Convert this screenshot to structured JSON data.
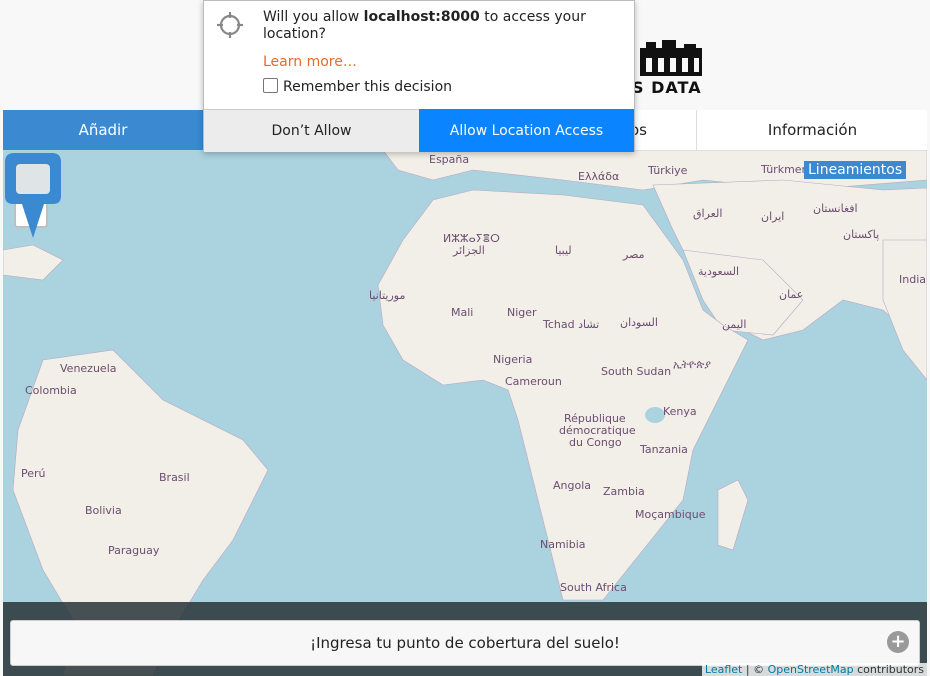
{
  "header": {
    "logo_text": "S DATA"
  },
  "tabs": [
    {
      "label": "Añadir"
    },
    {
      "label": "os"
    },
    {
      "label": "Información"
    }
  ],
  "map": {
    "zoom_in": "+",
    "zoom_out": "−",
    "lineamientos": "Lineamientos",
    "labels": {
      "espana": "España",
      "ellada": "Ελλάδα",
      "turkiye": "Türkiye",
      "turkmen": "Türkmen",
      "algeria_tifinagh": "ⵍⵣⵣⴰⵢⴻⵔ",
      "algeria": "الجزائر",
      "libya": "ليبيا",
      "egypt": "مصر",
      "iraq": "العراق",
      "iran": "ایران",
      "afghanistan": "افغانستان",
      "pakistan": "پاکستان",
      "saudi": "السعودية",
      "oman": "عمان",
      "india": "India",
      "mauritania": "موريتانيا",
      "mali": "Mali",
      "niger": "Niger",
      "tchad": "Tchad تشاد",
      "sudan": "السودان",
      "yemen": "اليمن",
      "ethiopia": "ኢትዮጵያ",
      "nigeria": "Nigeria",
      "cameroun": "Cameroun",
      "south_sudan": "South Sudan",
      "venezuela": "Venezuela",
      "colombia": "Colombia",
      "rdc_1": "République",
      "rdc_2": "démocratique",
      "rdc_3": "du Congo",
      "kenya": "Kenya",
      "tanzania": "Tanzania",
      "peru": "Perú",
      "brasil": "Brasil",
      "angola": "Angola",
      "zambia": "Zambia",
      "bolivia": "Bolivia",
      "mocambique": "Moçambique",
      "paraguay": "Paraguay",
      "namibia": "Namibia",
      "south_africa": "South Africa"
    }
  },
  "cta": {
    "label": "¡Ingresa tu punto de cobertura del suelo!",
    "icon": "plus-circle-icon"
  },
  "attribution": {
    "leaflet": "Leaflet",
    "sep": " | © ",
    "osm": "OpenStreetMap",
    "suffix": " contributors"
  },
  "permission_popup": {
    "msg_pre": "Will you allow ",
    "msg_host": "localhost:8000",
    "msg_post": " to access your location?",
    "learn_more": "Learn more…",
    "remember": "Remember this decision",
    "deny_label": "Don’t Allow",
    "allow_label": "Allow Location Access"
  },
  "colors": {
    "accent": "#3b89d1",
    "allow": "#0a84ff",
    "link": "#e66a2c",
    "water": "#aad3df",
    "land": "#f2efe9"
  }
}
